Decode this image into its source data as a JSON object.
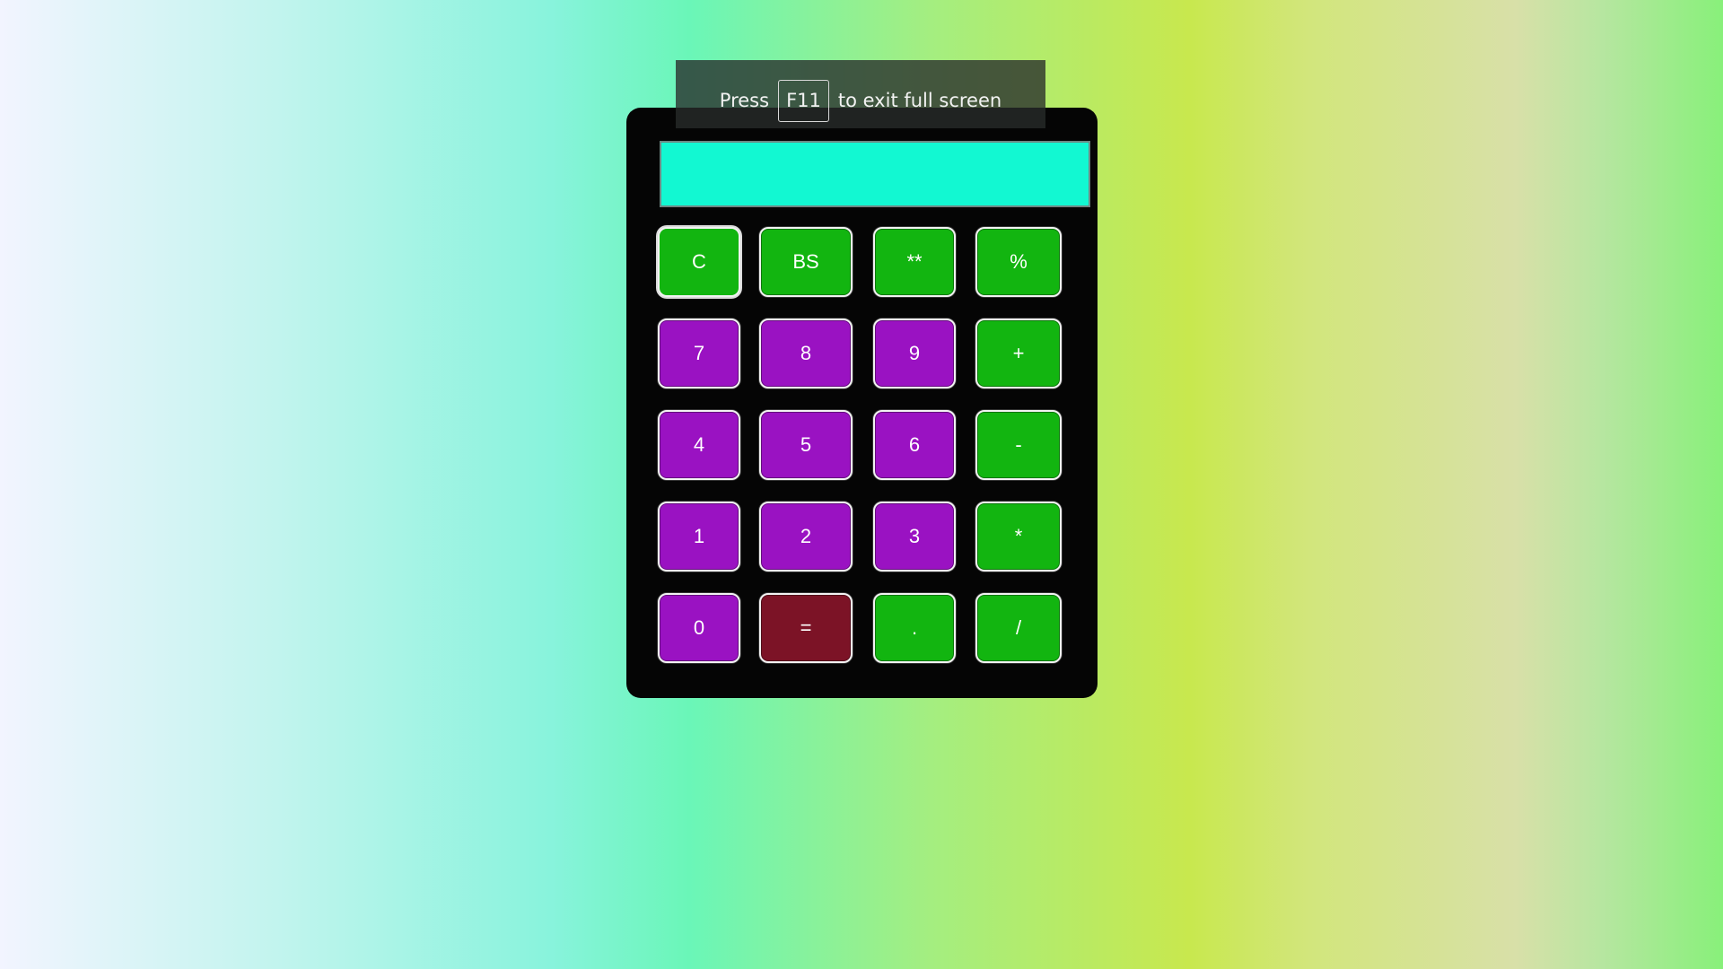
{
  "fullscreen_notice": {
    "prefix": "Press",
    "key": "F11",
    "suffix": "to exit full screen"
  },
  "display": {
    "value": ""
  },
  "keys": {
    "clear": "C",
    "backspace": "BS",
    "power": "**",
    "percent": "%",
    "seven": "7",
    "eight": "8",
    "nine": "9",
    "plus": "+",
    "four": "4",
    "five": "5",
    "six": "6",
    "minus": "-",
    "one": "1",
    "two": "2",
    "three": "3",
    "multiply": "*",
    "zero": "0",
    "equals": "=",
    "decimal": ".",
    "divide": "/"
  },
  "colors": {
    "display_background": "#12f8d2",
    "operator_key": "#12b510",
    "digit_key": "#9a12c2",
    "equals_key": "#7c1326",
    "calculator_body": "#050505"
  }
}
